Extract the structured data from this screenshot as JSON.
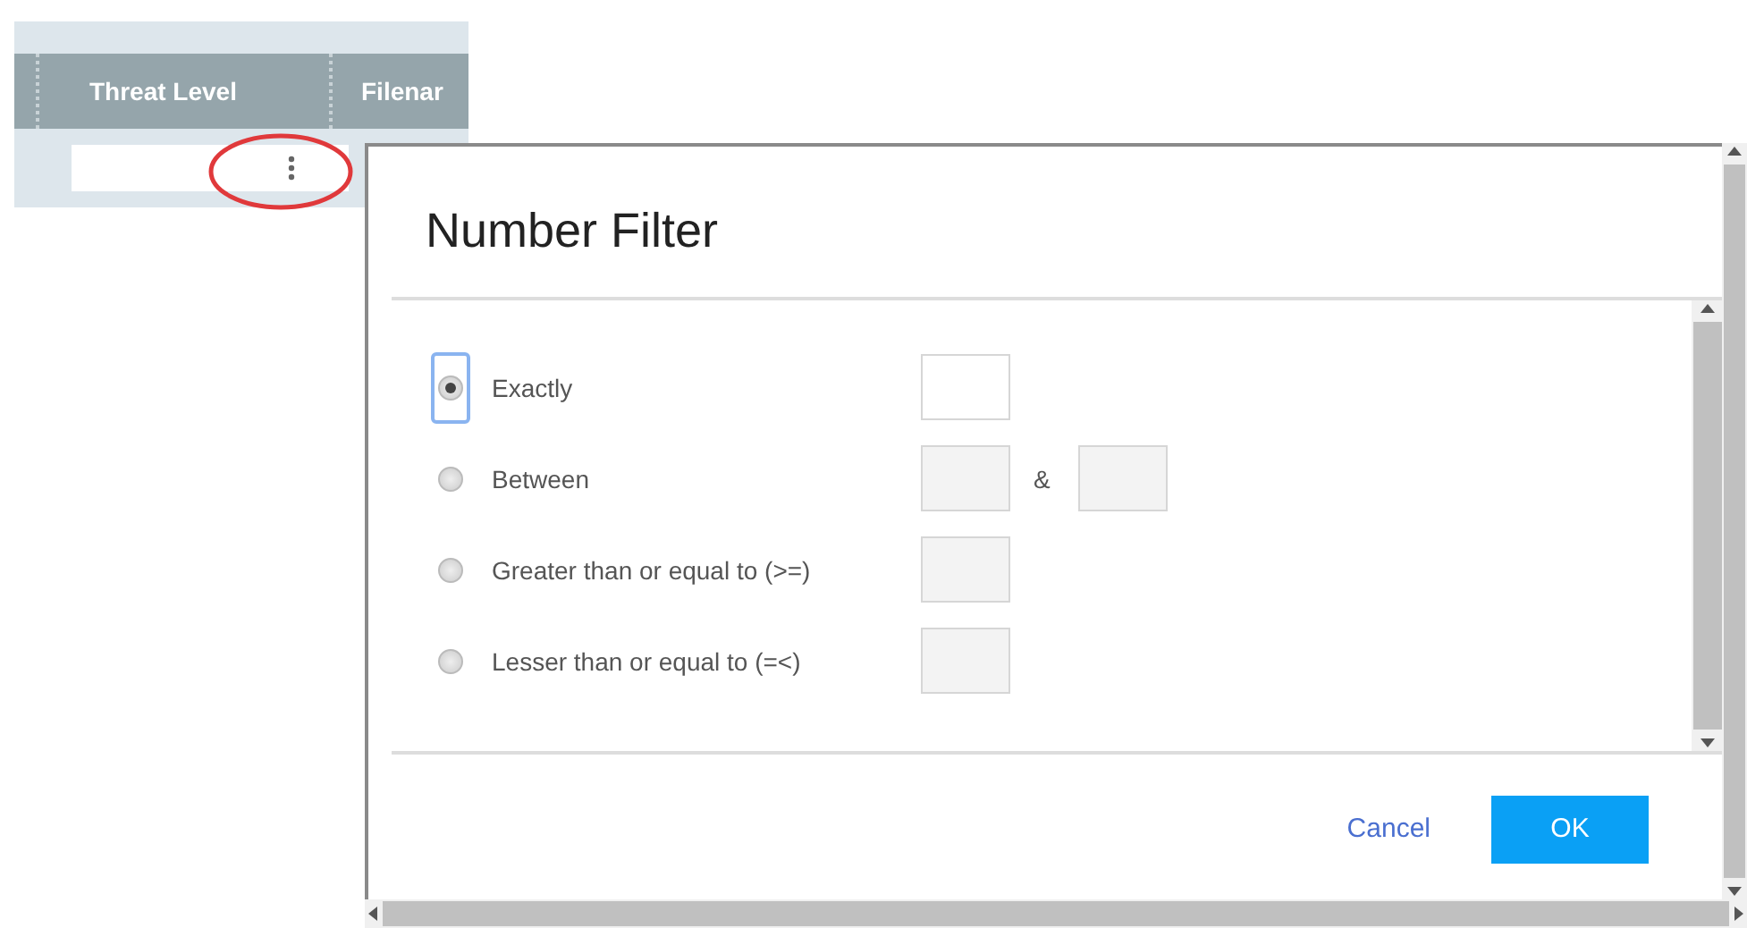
{
  "grid": {
    "columns": [
      "Threat Level",
      "Filenar"
    ]
  },
  "dialog": {
    "title": "Number Filter",
    "options": [
      {
        "label": "Exactly",
        "selected": true,
        "kind": "single"
      },
      {
        "label": "Between",
        "selected": false,
        "kind": "range",
        "joiner": "&"
      },
      {
        "label": "Greater than or equal to (>=)",
        "selected": false,
        "kind": "single"
      },
      {
        "label": "Lesser than or equal to (=<)",
        "selected": false,
        "kind": "single"
      }
    ],
    "buttons": [
      {
        "label": "Cancel",
        "kind": "link"
      },
      {
        "label": "OK",
        "kind": "primary"
      }
    ]
  }
}
